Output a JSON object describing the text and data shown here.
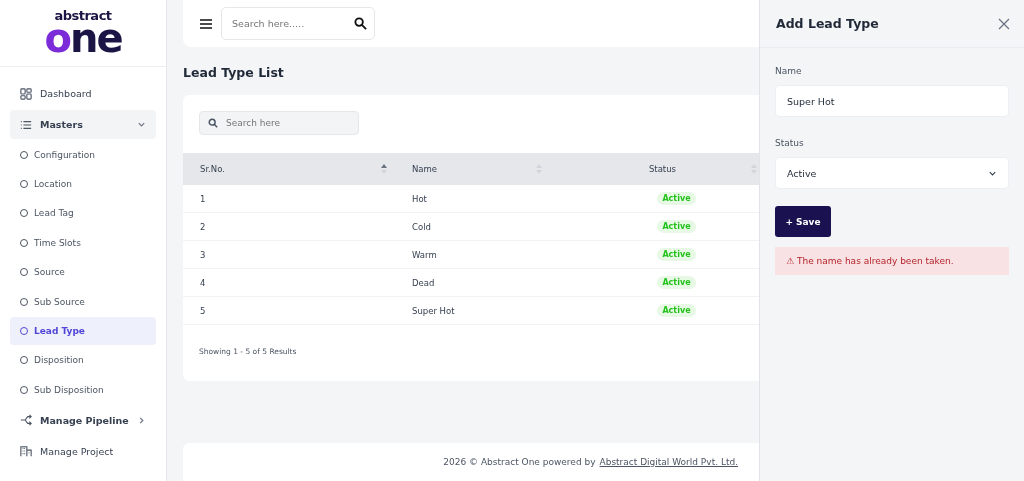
{
  "brand": {
    "top": "abstract",
    "bottom": "one"
  },
  "sidebar": {
    "items": [
      {
        "label": "Dashboard",
        "kind": "link",
        "selected": false
      },
      {
        "label": "Masters",
        "kind": "group",
        "selected": false,
        "expanded": true,
        "children": [
          {
            "label": "Configuration",
            "selected": false
          },
          {
            "label": "Location",
            "selected": false
          },
          {
            "label": "Lead Tag",
            "selected": false
          },
          {
            "label": "Time Slots",
            "selected": false
          },
          {
            "label": "Source",
            "selected": false
          },
          {
            "label": "Sub Source",
            "selected": false
          },
          {
            "label": "Lead Type",
            "selected": true
          },
          {
            "label": "Disposition",
            "selected": false
          },
          {
            "label": "Sub Disposition",
            "selected": false
          }
        ]
      },
      {
        "label": "Manage Pipeline",
        "kind": "group",
        "selected": false,
        "expanded": false
      },
      {
        "label": "Manage Project",
        "kind": "link",
        "selected": false
      }
    ]
  },
  "topbar": {
    "search": {
      "placeholder": "Search here....."
    }
  },
  "page_title": "Lead Type List",
  "table": {
    "search": {
      "placeholder": "Search here"
    },
    "columns": [
      {
        "label": "Sr.No.",
        "sorted": true
      },
      {
        "label": "Name",
        "sorted": false
      },
      {
        "label": "Status",
        "sorted": false
      }
    ],
    "rows": [
      {
        "sr": "1",
        "name": "Hot",
        "status": "Active"
      },
      {
        "sr": "2",
        "name": "Cold",
        "status": "Active"
      },
      {
        "sr": "3",
        "name": "Warm",
        "status": "Active"
      },
      {
        "sr": "4",
        "name": "Dead",
        "status": "Active"
      },
      {
        "sr": "5",
        "name": "Super Hot",
        "status": "Active"
      }
    ],
    "summary": "Showing 1 - 5 of 5 Results"
  },
  "footer": {
    "text": "2026 © Abstract One powered by",
    "link": "Abstract Digital World Pvt. Ltd."
  },
  "panel": {
    "title": "Add Lead Type",
    "name_field": {
      "label": "Name",
      "value": "Super Hot"
    },
    "status_field": {
      "label": "Status",
      "value": "Active"
    },
    "save_button": "+ Save",
    "error": "⚠ The name has already been taken."
  }
}
